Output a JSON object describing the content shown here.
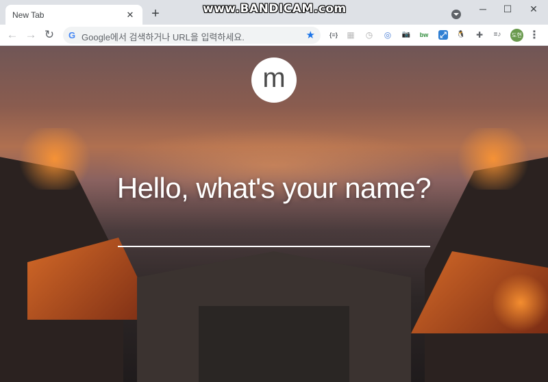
{
  "browser": {
    "tab": {
      "title": "New Tab",
      "close_glyph": "✕"
    },
    "new_tab_glyph": "+",
    "watermark": "www.BANDICAM.com",
    "window_controls": {
      "minimize": "─",
      "maximize": "☐",
      "close": "✕"
    },
    "toolbar": {
      "back_glyph": "←",
      "forward_glyph": "→",
      "reload_glyph": "↻",
      "omnibox": {
        "g_glyph": "G",
        "placeholder": "Google에서 검색하거나 URL을 입력하세요.",
        "star_glyph": "★"
      },
      "extensions": [
        {
          "name": "json-viewer-icon",
          "glyph": "{≡}"
        },
        {
          "name": "grid-extension-icon",
          "glyph": "▦"
        },
        {
          "name": "timer-extension-icon",
          "glyph": "◷"
        },
        {
          "name": "circle-extension-icon",
          "glyph": "◎"
        },
        {
          "name": "camera-extension-icon",
          "glyph": "📷"
        },
        {
          "name": "green-extension-icon",
          "glyph": "bw"
        },
        {
          "name": "resize-extension-icon",
          "glyph": "⤢"
        },
        {
          "name": "linux-extension-icon",
          "glyph": "🐧"
        },
        {
          "name": "puzzle-extensions-icon",
          "glyph": "✚"
        },
        {
          "name": "media-queue-icon",
          "glyph": "≡♪"
        }
      ],
      "avatar_text": "도현",
      "menu_glyph": "⋮"
    }
  },
  "momentum": {
    "logo_letter": "m",
    "greeting": "Hello, what's your name?",
    "name_input_value": ""
  },
  "colors": {
    "tabstrip": "#dee1e6",
    "accent_star": "#1a73e8",
    "avatar_bg": "#6a9a4e"
  }
}
